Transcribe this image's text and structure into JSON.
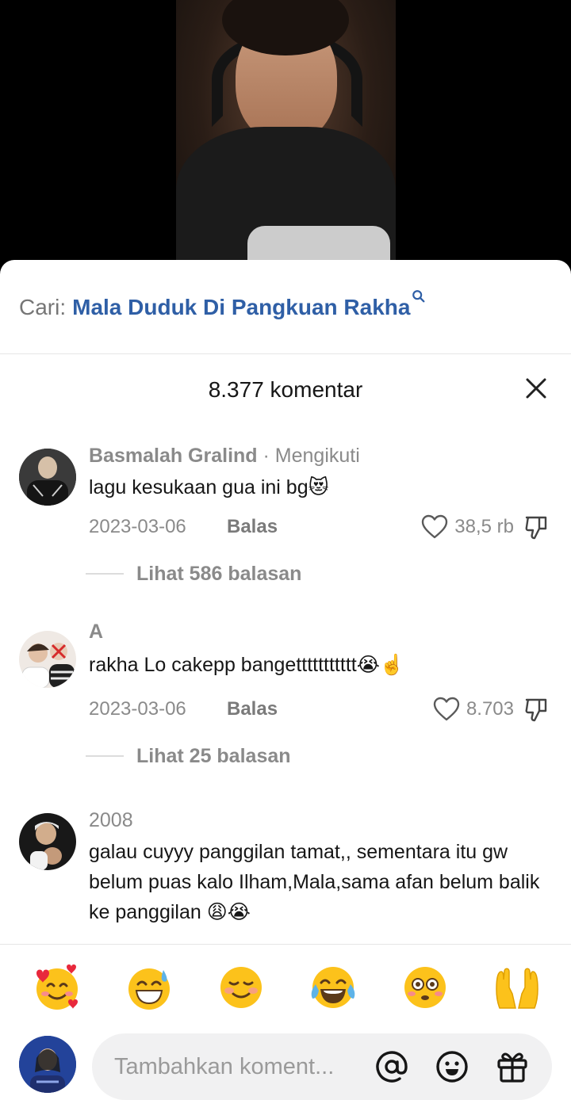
{
  "search": {
    "prefix": "Cari:",
    "term": "Mala Duduk Di Pangkuan Rakha",
    "icon": "search-icon"
  },
  "comments_header": {
    "title": "8.377 komentar",
    "close_icon": "close-icon"
  },
  "comments": [
    {
      "author": "Basmalah Gralind",
      "follow_status": "· Mengikuti",
      "text": "lagu kesukaan gua ini bg😻",
      "date": "2023-03-06",
      "reply_label": "Balas",
      "likes": "38,5 rb",
      "replies_label": "Lihat 586 balasan"
    },
    {
      "author": "A",
      "follow_status": "",
      "text": "rakha Lo cakepp bangettttttttttt😭☝️",
      "date": "2023-03-06",
      "reply_label": "Balas",
      "likes": "8.703",
      "replies_label": "Lihat 25 balasan"
    },
    {
      "author": "2008",
      "follow_status": "",
      "text": "galau cuyyy panggilan tamat,, sementara itu gw belum puas kalo Ilham,Mala,sama afan belum balik ke panggilan 😩😭",
      "date": "",
      "reply_label": "",
      "likes": "",
      "replies_label": ""
    }
  ],
  "emoji_bar": [
    "smiling-face-with-hearts",
    "grinning-face-with-sweat",
    "smiling-face-blushing",
    "face-with-tears-of-joy",
    "flushed-face",
    "palms-up-together"
  ],
  "composer": {
    "placeholder": "Tambahkan koment...",
    "icons": [
      "at-icon",
      "emoji-icon",
      "gift-icon"
    ]
  },
  "colors": {
    "accent_link": "#2f5fa6",
    "muted_text": "#8a8a8a",
    "primary_text": "#161616",
    "composer_bg": "#f1f1f2"
  }
}
